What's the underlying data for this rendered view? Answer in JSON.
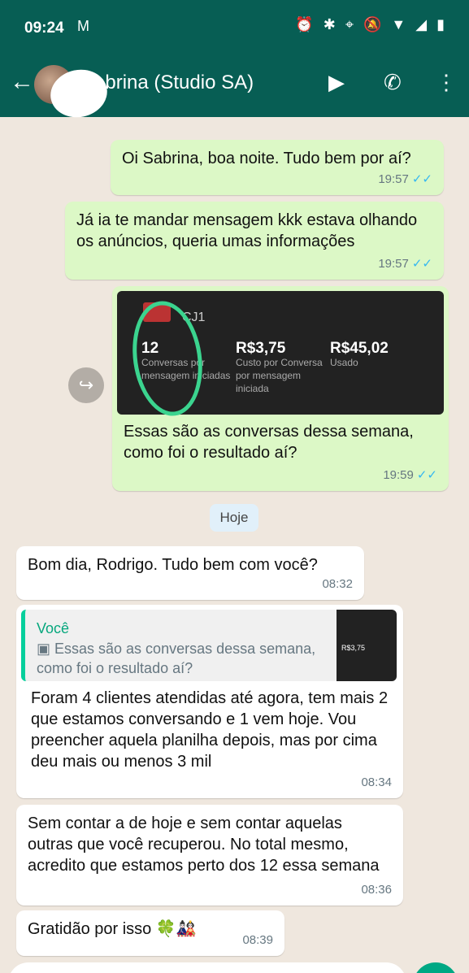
{
  "status_bar": {
    "time": "09:24",
    "mail_icon": "M",
    "icons": [
      "⏰",
      "✱",
      "⌖",
      "🔕",
      "▼",
      "◢",
      "▮"
    ]
  },
  "header": {
    "back_icon": "←",
    "contact_name": "Sabrina (Studio SA)",
    "video_icon": "▶",
    "call_icon": "✆",
    "menu_icon": "⋮"
  },
  "messages": {
    "m1": {
      "text": "Oi Sabrina, boa noite. Tudo bem por aí?",
      "time": "19:57",
      "ticks": "✓✓"
    },
    "m2": {
      "text": "Já ia te mandar mensagem kkk estava olhando os anúncios, queria umas informações",
      "time": "19:57",
      "ticks": "✓✓"
    },
    "m3": {
      "card": {
        "name": "CJ1",
        "stat1_value": "12",
        "stat1_label": "Conversas por mensagem iniciadas",
        "stat2_value": "R$3,75",
        "stat2_label": "Custo por Conversa por mensagem iniciada",
        "stat3_value": "R$45,02",
        "stat3_label": "Usado"
      },
      "text": "Essas são as conversas dessa semana, como foi o resultado aí?",
      "time": "19:59",
      "ticks": "✓✓"
    },
    "day_divider": "Hoje",
    "m4": {
      "text": "Bom dia, Rodrigo. Tudo bem com você?",
      "time": "08:32"
    },
    "m5": {
      "quote_name": "Você",
      "quote_text": "▣ Essas são as conversas dessa semana, como foi o resultado aí?",
      "quote_thumb": "R$3,75",
      "text": "Foram 4 clientes atendidas até agora, tem mais 2 que estamos conversando e 1 vem hoje. Vou preencher aquela planilha depois, mas por cima deu mais ou menos 3 mil",
      "time": "08:34"
    },
    "m6": {
      "text": "Sem contar a de hoje e sem contar aquelas outras que você recuperou. No total mesmo, acredito que estamos perto dos 12 essa semana",
      "time": "08:36"
    },
    "m7": {
      "text": "Gratidão por isso 🍀🎎",
      "time": "08:39"
    }
  },
  "forward_icon": "↪",
  "colors": {
    "header": "#075e54",
    "outgoing": "#dcf8c6",
    "incoming": "#ffffff",
    "accent": "#00a884"
  }
}
